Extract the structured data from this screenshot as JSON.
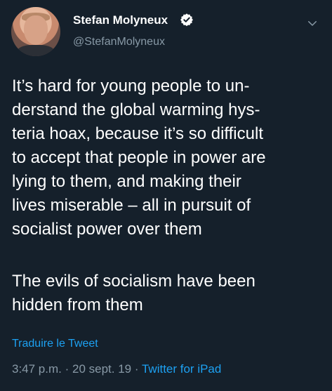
{
  "author": {
    "display_name": "Stefan Molyneux",
    "handle": "@StefanMolyneux",
    "verified_icon": "verified-badge-icon",
    "avatar": "profile-photo"
  },
  "tweet": {
    "paragraph1_lines": [
      "It’s hard for young people to un-",
      "derstand the global warming hys-",
      "teria hoax, because it’s so difficult",
      "to accept that people in power are",
      "lying to them, and making their",
      "lives miserable – all in pursuit of",
      "socialist power over them"
    ],
    "paragraph2_lines": [
      "The evils of socialism have been",
      "hidden from them"
    ],
    "translate_label": "Traduire le Tweet",
    "time": "3:47 p.m.",
    "separator": "·",
    "date": "20 sept. 19",
    "source": "Twitter for iPad"
  },
  "colors": {
    "background": "#15202b",
    "text": "#ffffff",
    "secondary": "#8899a6",
    "link": "#1da1f2"
  }
}
